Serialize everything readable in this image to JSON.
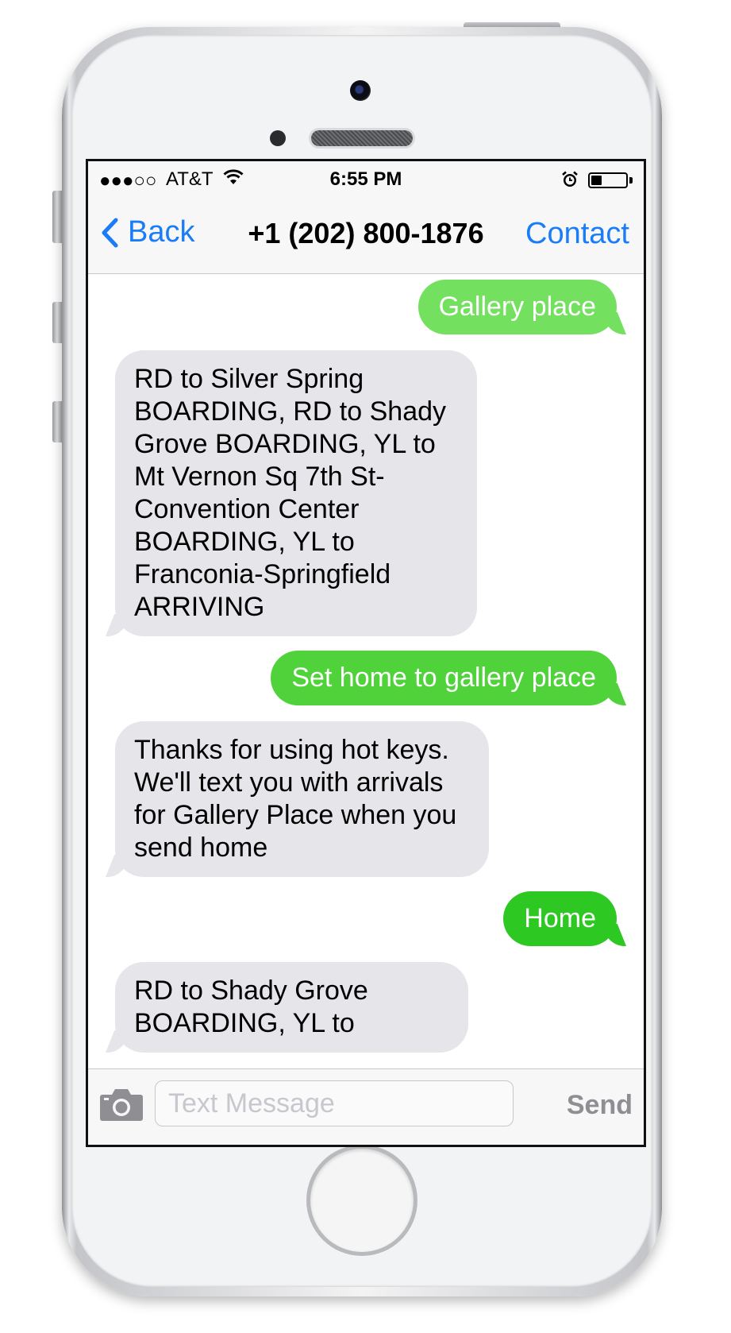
{
  "status_bar": {
    "signal": "●●●○○",
    "carrier": "AT&T",
    "time": "6:55 PM",
    "battery_level": 0.3
  },
  "nav": {
    "back_label": "Back",
    "title": "+1 (202) 800-1876",
    "contact_label": "Contact"
  },
  "messages": [
    {
      "from": "me",
      "text": "Gallery place",
      "color": "#74e060"
    },
    {
      "from": "them",
      "lines": [
        "RD to Silver Spring",
        "BOARDING, RD to Shady",
        "Grove BOARDING, YL to",
        "Mt Vernon Sq 7th St-",
        "Convention Center",
        "BOARDING, YL to",
        "Franconia-Springfield",
        "ARRIVING"
      ]
    },
    {
      "from": "me",
      "text": "Set home to gallery place",
      "color": "#4fd23a"
    },
    {
      "from": "them",
      "lines": [
        "Thanks for using hot keys.",
        "We'll text you with arrivals",
        "for Gallery Place when you",
        "send home"
      ]
    },
    {
      "from": "me",
      "text": "Home",
      "color": "#2ec822"
    },
    {
      "from": "them",
      "lines": [
        "RD to Shady Grove",
        "BOARDING, YL to"
      ]
    }
  ],
  "composer": {
    "placeholder": "Text Message",
    "send_label": "Send"
  },
  "colors": {
    "ios_blue": "#1a7cf6",
    "received_bubble": "#e5e5ea",
    "send_disabled": "#8e8e93"
  },
  "icons": {
    "back": "chevron-left-icon",
    "wifi": "wifi-icon",
    "alarm": "alarm-clock-icon",
    "battery": "battery-icon",
    "camera": "camera-icon"
  }
}
